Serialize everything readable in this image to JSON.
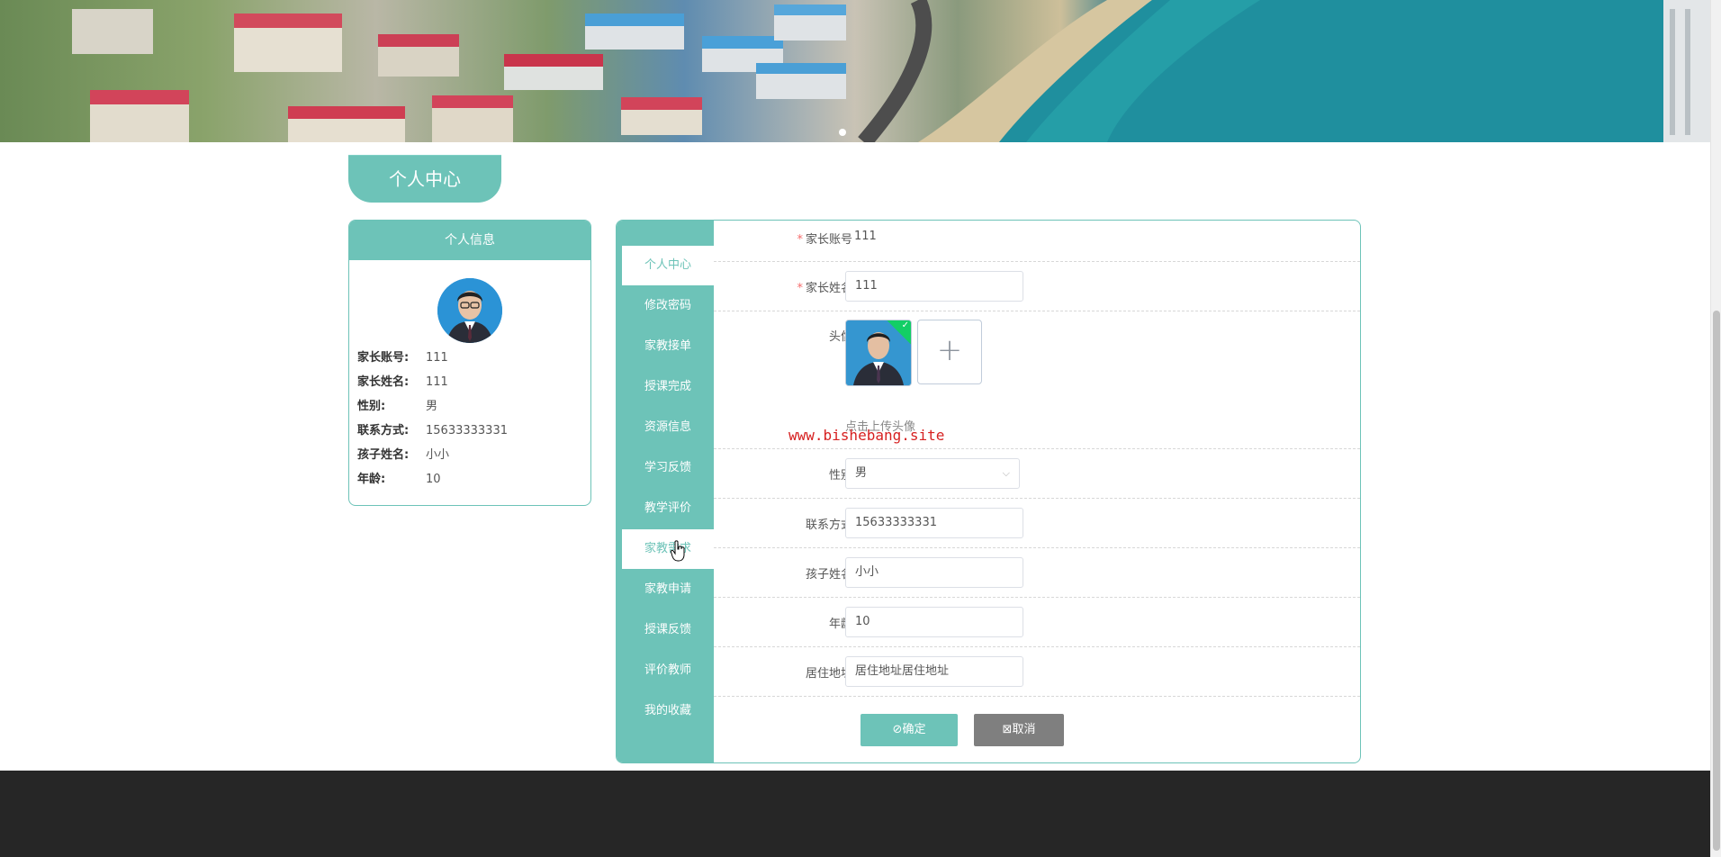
{
  "page_title": "个人中心",
  "info_card": {
    "header": "个人信息",
    "rows": [
      {
        "label": "家长账号:",
        "value": "111"
      },
      {
        "label": "家长姓名:",
        "value": "111"
      },
      {
        "label": "性别:",
        "value": "男"
      },
      {
        "label": "联系方式:",
        "value": "15633333331"
      },
      {
        "label": "孩子姓名:",
        "value": "小小"
      },
      {
        "label": "年龄:",
        "value": "10"
      }
    ]
  },
  "menu": [
    {
      "label": "个人中心",
      "active": true
    },
    {
      "label": "修改密码"
    },
    {
      "label": "家教接单"
    },
    {
      "label": "授课完成"
    },
    {
      "label": "资源信息"
    },
    {
      "label": "学习反馈"
    },
    {
      "label": "教学评价"
    },
    {
      "label": "家教需求",
      "hovered": true
    },
    {
      "label": "家教申请"
    },
    {
      "label": "授课反馈"
    },
    {
      "label": "评价教师"
    },
    {
      "label": "我的收藏"
    }
  ],
  "form": {
    "account": {
      "label": "家长账号",
      "value": "111",
      "required": true
    },
    "name": {
      "label": "家长姓名",
      "value": "111",
      "required": true
    },
    "avatar": {
      "label": "头像",
      "hint": "点击上传头像",
      "add_icon": "+"
    },
    "gender": {
      "label": "性别",
      "value": "男"
    },
    "phone": {
      "label": "联系方式",
      "value": "15633333331"
    },
    "child_name": {
      "label": "孩子姓名",
      "value": "小小"
    },
    "age": {
      "label": "年龄",
      "value": "10"
    },
    "address": {
      "label": "居住地址",
      "value": "居住地址居住地址"
    },
    "required_mark": "*"
  },
  "buttons": {
    "confirm": "⊘确定",
    "cancel": "⊠取消"
  },
  "watermark": "www.bishebang.site",
  "colors": {
    "accent": "#6dc3b8",
    "footer": "#262626",
    "cancel_button": "#7f7f7f"
  },
  "icons": {
    "cursor": "hand-pointer-icon",
    "upload_success": "check-icon",
    "select_arrow": "chevron-down-icon"
  }
}
